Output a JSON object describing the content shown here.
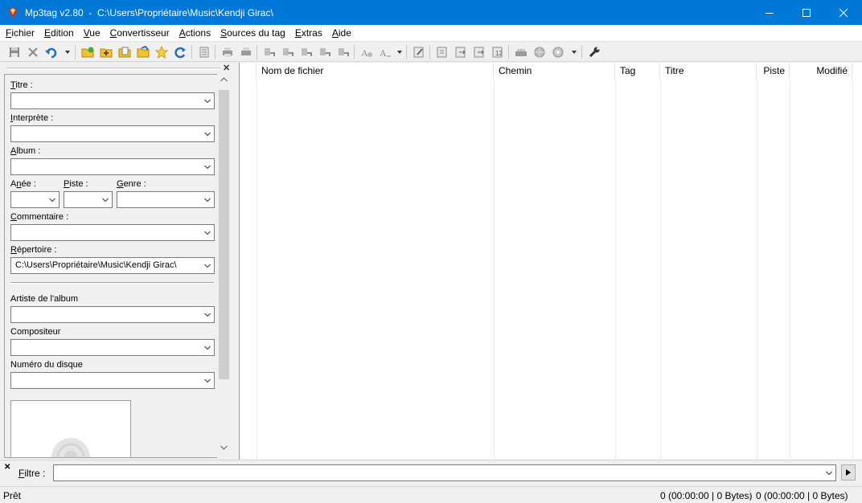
{
  "window": {
    "app_title": "Mp3tag v2.80  -  C:\\Users\\Propriétaire\\Music\\Kendji Girac\\"
  },
  "menu": {
    "items": [
      {
        "first": "F",
        "rest": "ichier"
      },
      {
        "first": "E",
        "rest": "dition"
      },
      {
        "first": "V",
        "rest": "ue"
      },
      {
        "first": "C",
        "rest": "onvertisseur"
      },
      {
        "first": "A",
        "rest": "ctions"
      },
      {
        "first": "S",
        "rest": "ources du tag"
      },
      {
        "first": "E",
        "rest": "xtras"
      },
      {
        "first": "A",
        "rest": "ide"
      }
    ]
  },
  "tag_panel": {
    "titre": {
      "first": "T",
      "rest": "itre :"
    },
    "interprete": {
      "first": "I",
      "rest": "nterprète :"
    },
    "album": {
      "first": "A",
      "rest": "lbum :"
    },
    "annee": {
      "first": "n",
      "pre": "A",
      "rest": "ée :"
    },
    "piste": {
      "first": "P",
      "rest": "iste :"
    },
    "genre": {
      "first": "G",
      "rest": "enre :"
    },
    "commentaire": {
      "first": "C",
      "rest": "ommentaire :"
    },
    "repertoire": {
      "first": "R",
      "rest": "épertoire :",
      "value": "C:\\Users\\Propriétaire\\Music\\Kendji Girac\\"
    },
    "artiste_album": "Artiste de l'album",
    "compositeur": "Compositeur",
    "numero_disque": "Numéro du disque"
  },
  "file_list": {
    "columns": [
      "Nom de fichier",
      "Chemin",
      "Tag",
      "Titre",
      "Piste",
      "Modifié"
    ]
  },
  "filter": {
    "label_first": "F",
    "label_rest": "iltre :"
  },
  "status": {
    "text": "Prêt",
    "selected": "0 (00:00:00 | 0 Bytes)",
    "total": "0 (00:00:00 | 0 Bytes)"
  },
  "colors": {
    "titlebar": "#0078d7",
    "accent_blue": "#1e6fc8",
    "folder_yellow": "#f2c12e"
  }
}
